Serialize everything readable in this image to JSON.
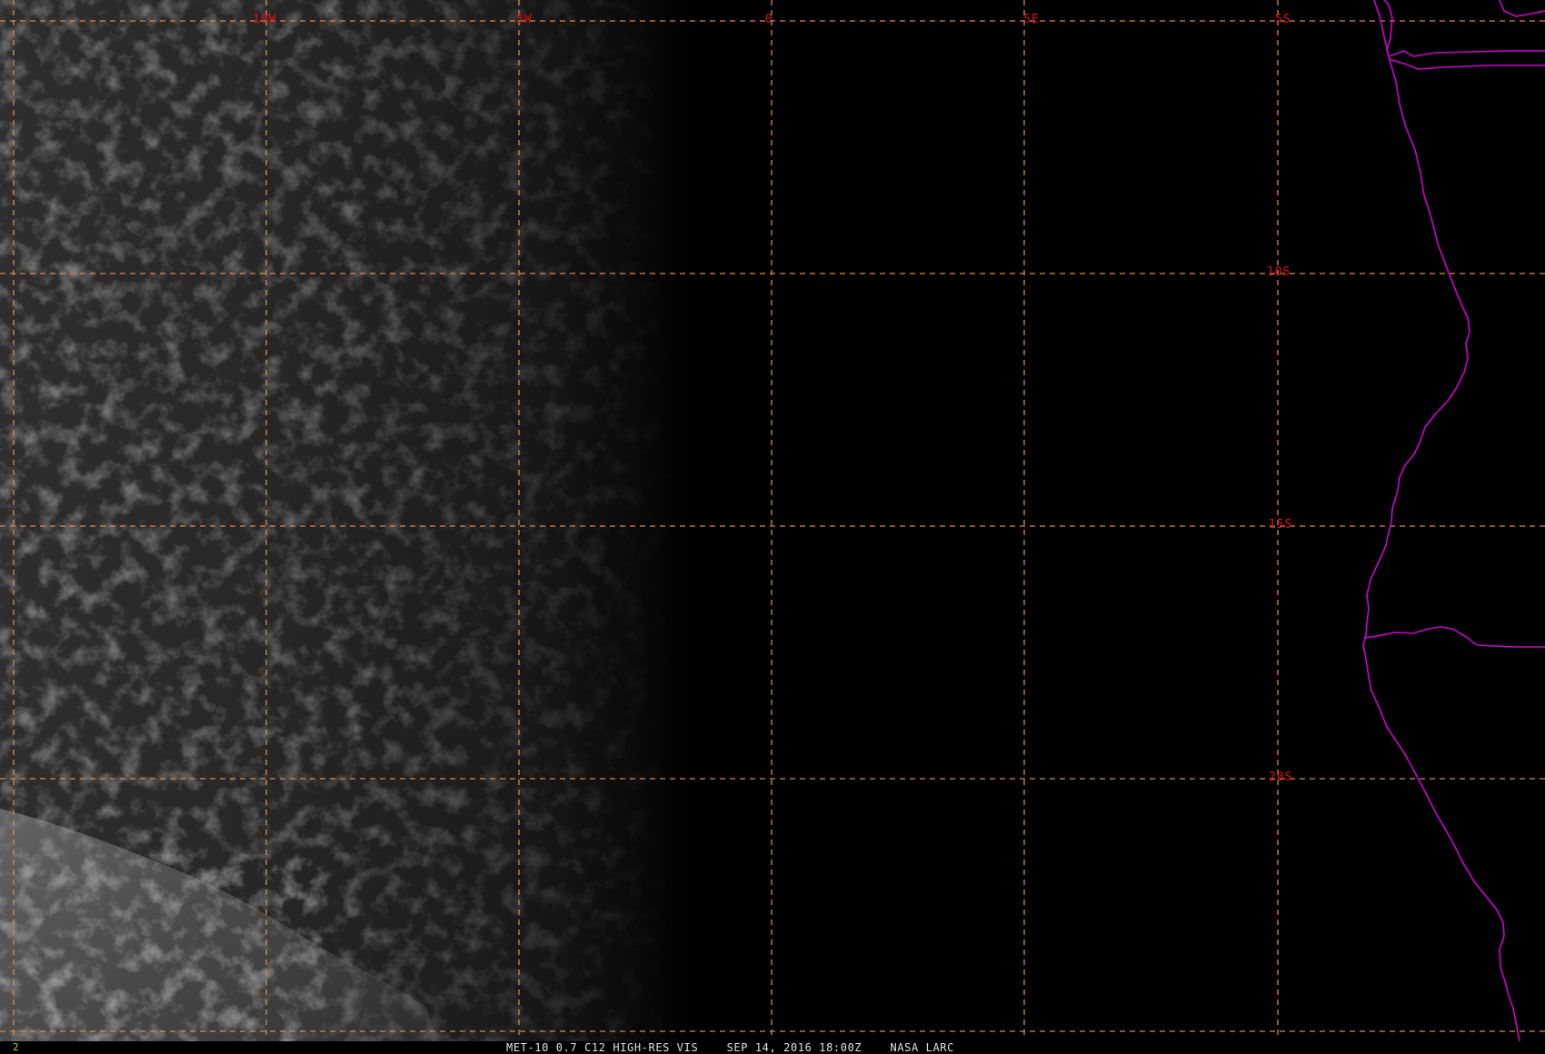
{
  "image": {
    "caption": "MET-10 0.7 C12 HIGH-RES VIS    SEP 14, 2016 18:00Z    NASA LARC",
    "frame_number": "2"
  },
  "grid": {
    "longitude_labels": [
      "10W",
      "5W",
      "0",
      "5E"
    ],
    "latitude_labels": [
      "5S",
      "10S",
      "15S",
      "20S"
    ]
  },
  "colors": {
    "background": "#000000",
    "gridline": "#d98a4a",
    "grid_label": "#e01010",
    "coastline": "#d000d0",
    "frame_number": "#e8c200",
    "caption": "#e0e0e0"
  }
}
